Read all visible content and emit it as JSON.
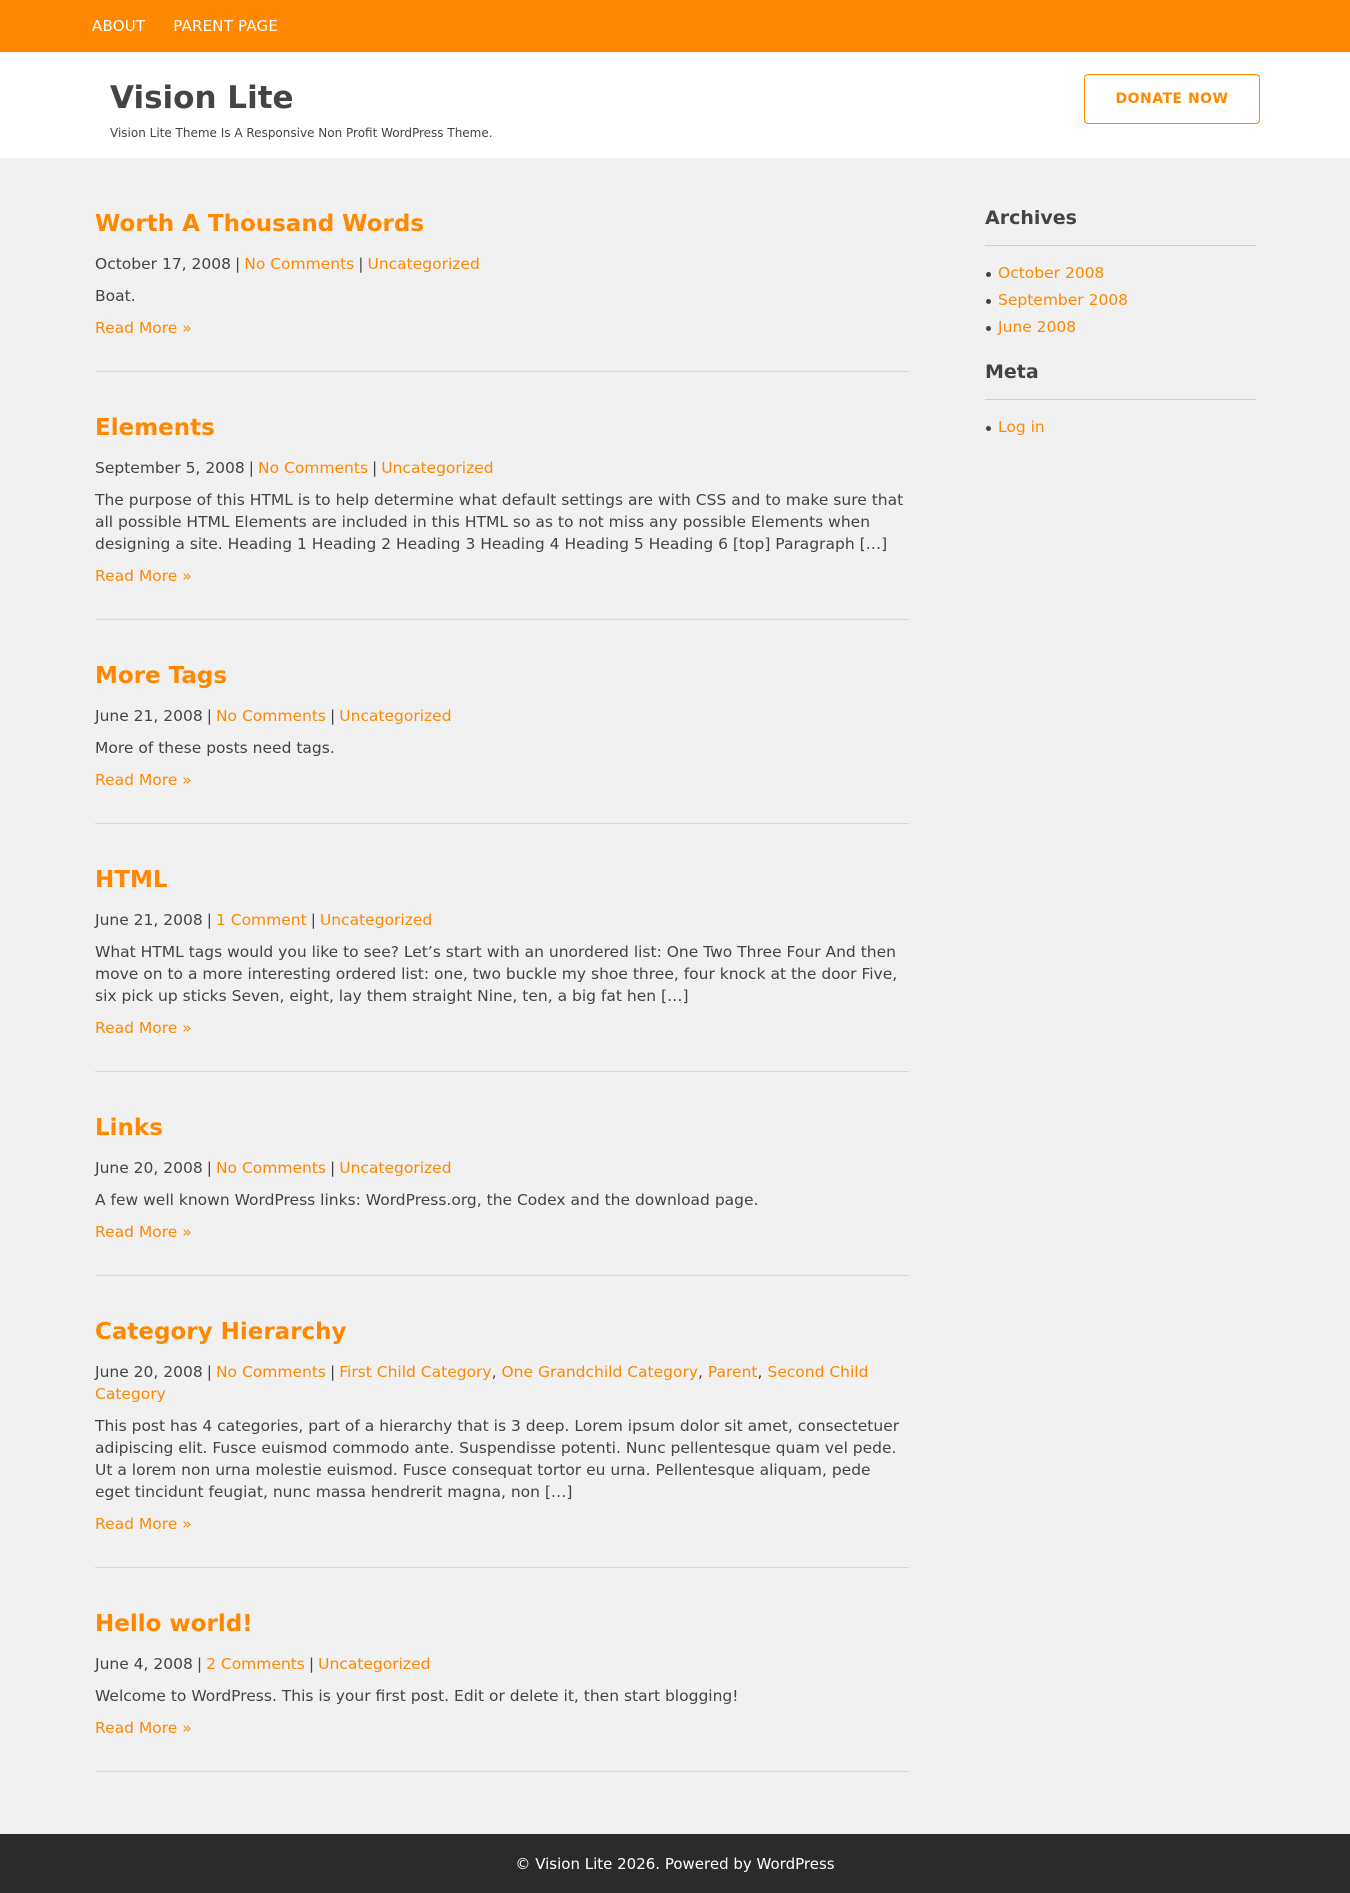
{
  "nav": {
    "items": [
      {
        "label": "ABOUT"
      },
      {
        "label": "PARENT PAGE"
      }
    ]
  },
  "header": {
    "title": "Vision Lite",
    "tagline": "Vision Lite Theme Is A Responsive Non Profit WordPress Theme.",
    "donate_label": "DONATE NOW"
  },
  "posts": [
    {
      "title": "Worth A Thousand Words",
      "date": "October 17, 2008",
      "comments": "No Comments",
      "categories": [
        "Uncategorized"
      ],
      "excerpt": "Boat.",
      "read_more": "Read More »"
    },
    {
      "title": "Elements",
      "date": "September 5, 2008",
      "comments": "No Comments",
      "categories": [
        "Uncategorized"
      ],
      "excerpt": "The purpose of this HTML is to help determine what default settings are with CSS and to make sure that all possible HTML Elements are included in this HTML so as to not miss any possible Elements when designing a site. Heading 1 Heading 2 Heading 3 Heading 4 Heading 5 Heading 6 [top] Paragraph […]",
      "read_more": "Read More »"
    },
    {
      "title": "More Tags",
      "date": "June 21, 2008",
      "comments": "No Comments",
      "categories": [
        "Uncategorized"
      ],
      "excerpt": "More of these posts need tags.",
      "read_more": "Read More »"
    },
    {
      "title": "HTML",
      "date": "June 21, 2008",
      "comments": "1 Comment",
      "categories": [
        "Uncategorized"
      ],
      "excerpt": "What HTML tags would you like to see? Let’s start with an unordered list: One Two Three Four And then move on to a more interesting ordered list: one, two buckle my shoe three, four knock at the door Five, six pick up sticks Seven, eight, lay them straight Nine, ten, a big fat hen […]",
      "read_more": "Read More »"
    },
    {
      "title": "Links",
      "date": "June 20, 2008",
      "comments": "No Comments",
      "categories": [
        "Uncategorized"
      ],
      "excerpt": "A few well known WordPress links: WordPress.org, the Codex and the download page.",
      "read_more": "Read More »"
    },
    {
      "title": "Category Hierarchy",
      "date": "June 20, 2008",
      "comments": "No Comments",
      "categories": [
        "First Child Category",
        "One Grandchild Category",
        "Parent",
        "Second Child Category"
      ],
      "excerpt": "This post has 4 categories, part of a hierarchy that is 3 deep. Lorem ipsum dolor sit amet, consectetuer adipiscing elit. Fusce euismod commodo ante. Suspendisse potenti. Nunc pellentesque quam vel pede. Ut a lorem non urna molestie euismod. Fusce consequat tortor eu urna. Pellentesque aliquam, pede eget tincidunt feugiat, nunc massa hendrerit magna, non […]",
      "read_more": "Read More »"
    },
    {
      "title": "Hello world!",
      "date": "June 4, 2008",
      "comments": "2 Comments",
      "categories": [
        "Uncategorized"
      ],
      "excerpt": "Welcome to WordPress. This is your first post. Edit or delete it, then start blogging!",
      "read_more": "Read More »"
    }
  ],
  "sidebar": {
    "archives": {
      "title": "Archives",
      "items": [
        "October 2008",
        "September 2008",
        "June 2008"
      ]
    },
    "meta": {
      "title": "Meta",
      "items": [
        "Log in"
      ]
    }
  },
  "footer": {
    "text": "© Vision Lite 2026. Powered by WordPress"
  },
  "colors": {
    "accent": "#ff8800",
    "text": "#444444",
    "background": "#f1f1f1",
    "footer": "#2b2b2b"
  }
}
